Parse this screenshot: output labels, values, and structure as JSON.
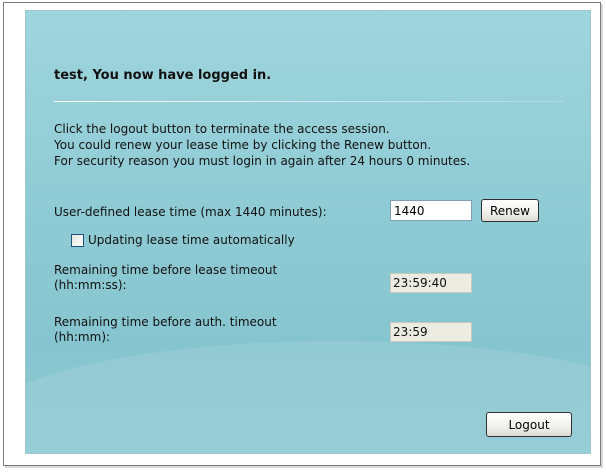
{
  "header": {
    "title": "test, You now have logged in."
  },
  "info": {
    "line1": "Click the logout button to terminate the access session.",
    "line2": "You could renew your lease time by clicking the Renew button.",
    "line3": "For security reason you must login in again after 24 hours 0 minutes."
  },
  "lease": {
    "label": "User-defined lease time (max 1440 minutes):",
    "value": "1440",
    "renew_label": "Renew"
  },
  "auto_update": {
    "label": "Updating lease time automatically",
    "checked": false
  },
  "remaining_lease": {
    "label_line1": "Remaining time before lease timeout",
    "label_line2": "(hh:mm:ss):",
    "value": "23:59:40"
  },
  "remaining_auth": {
    "label_line1": "Remaining time before auth. timeout",
    "label_line2": "(hh:mm):",
    "value": "23:59"
  },
  "actions": {
    "logout_label": "Logout"
  }
}
